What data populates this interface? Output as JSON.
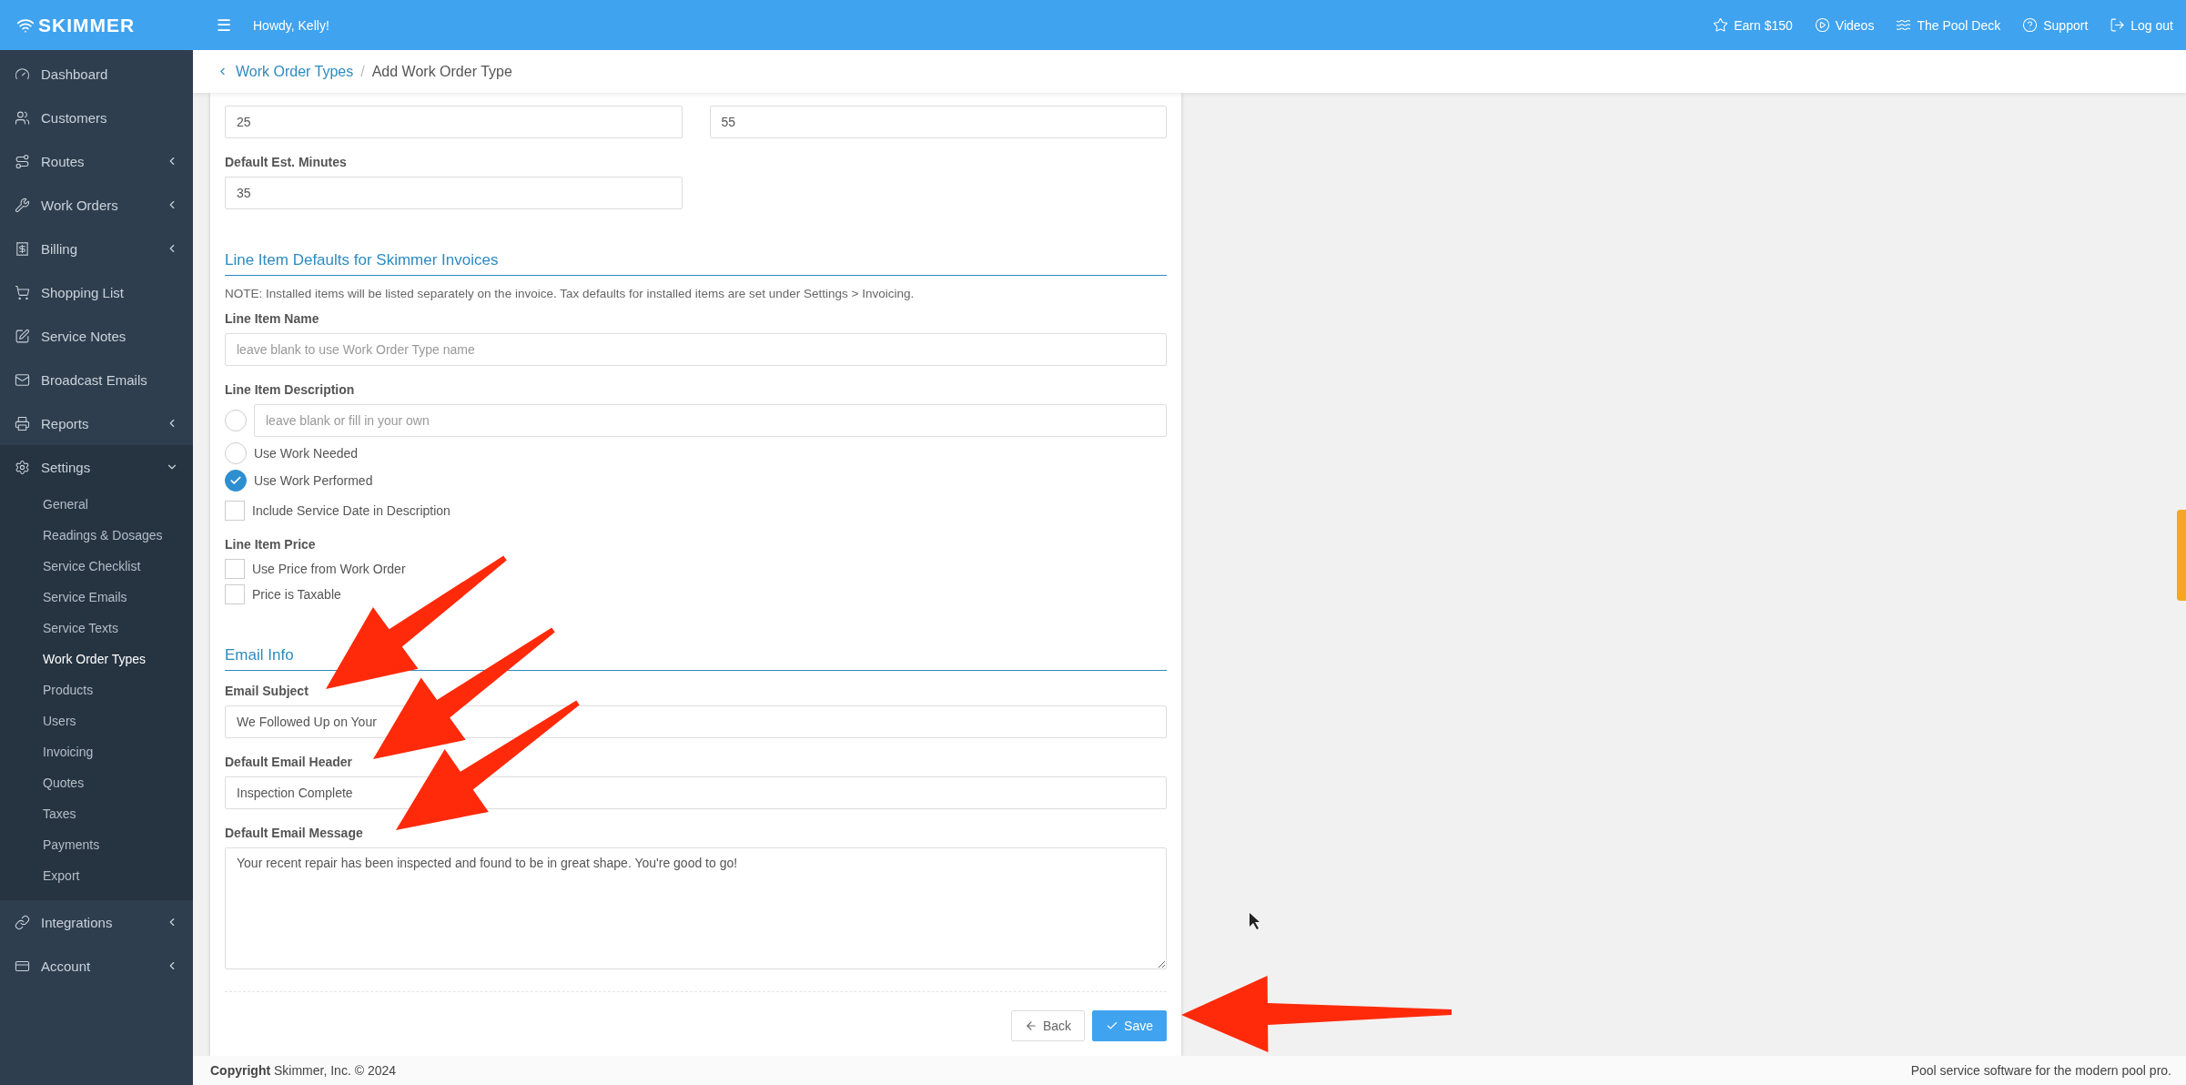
{
  "brand": "SKIMMER",
  "topbar": {
    "greeting": "Howdy, Kelly!",
    "menu_glyph": "☰",
    "links": [
      {
        "label": "Earn $150"
      },
      {
        "label": "Videos"
      },
      {
        "label": "The Pool Deck"
      },
      {
        "label": "Support"
      },
      {
        "label": "Log out"
      }
    ]
  },
  "sidebar": {
    "items": [
      {
        "label": "Dashboard",
        "has_submenu": false,
        "expanded": false
      },
      {
        "label": "Customers",
        "has_submenu": false,
        "expanded": false
      },
      {
        "label": "Routes",
        "has_submenu": true,
        "expanded": false
      },
      {
        "label": "Work Orders",
        "has_submenu": true,
        "expanded": false
      },
      {
        "label": "Billing",
        "has_submenu": true,
        "expanded": false
      },
      {
        "label": "Shopping List",
        "has_submenu": false,
        "expanded": false
      },
      {
        "label": "Service Notes",
        "has_submenu": false,
        "expanded": false
      },
      {
        "label": "Broadcast Emails",
        "has_submenu": false,
        "expanded": false
      },
      {
        "label": "Reports",
        "has_submenu": true,
        "expanded": false
      },
      {
        "label": "Settings",
        "has_submenu": true,
        "expanded": true,
        "children": [
          {
            "label": "General",
            "selected": false
          },
          {
            "label": "Readings & Dosages",
            "selected": false
          },
          {
            "label": "Service Checklist",
            "selected": false
          },
          {
            "label": "Service Emails",
            "selected": false
          },
          {
            "label": "Service Texts",
            "selected": false
          },
          {
            "label": "Work Order Types",
            "selected": true
          },
          {
            "label": "Products",
            "selected": false
          },
          {
            "label": "Users",
            "selected": false
          },
          {
            "label": "Invoicing",
            "selected": false
          },
          {
            "label": "Quotes",
            "selected": false
          },
          {
            "label": "Taxes",
            "selected": false
          },
          {
            "label": "Payments",
            "selected": false
          },
          {
            "label": "Export",
            "selected": false
          }
        ]
      },
      {
        "label": "Integrations",
        "has_submenu": true,
        "expanded": false
      },
      {
        "label": "Account",
        "has_submenu": true,
        "expanded": false
      }
    ]
  },
  "breadcrumb": {
    "parent": "Work Order Types",
    "separator": "/",
    "current": "Add Work Order Type"
  },
  "form": {
    "top_fields": [
      {
        "value": "25"
      },
      {
        "value": "55"
      }
    ],
    "est_minutes": {
      "label": "Default Est. Minutes",
      "value": "35"
    },
    "line_item_section": {
      "heading": "Line Item Defaults for Skimmer Invoices",
      "note": "NOTE: Installed items will be listed separately on the invoice. Tax defaults for installed items are set under Settings > Invoicing.",
      "name_label": "Line Item Name",
      "name_placeholder": "leave blank to use Work Order Type name",
      "description_label": "Line Item Description",
      "description_options": [
        {
          "kind": "input",
          "placeholder": "leave blank or fill in your own",
          "selected": false
        },
        {
          "kind": "text",
          "label": "Use Work Needed",
          "selected": false
        },
        {
          "kind": "text",
          "label": "Use Work Performed",
          "selected": true
        }
      ],
      "include_date": {
        "label": "Include Service Date in Description",
        "checked": false
      },
      "price_label": "Line Item Price",
      "price_options": [
        {
          "label": "Use Price from Work Order",
          "checked": false
        },
        {
          "label": "Price is Taxable",
          "checked": false
        }
      ]
    },
    "email_section": {
      "heading": "Email Info",
      "fields": [
        {
          "kind": "input",
          "label": "Email Subject",
          "value": "We Followed Up on Your"
        },
        {
          "kind": "input",
          "label": "Default Email Header",
          "value": "Inspection Complete"
        },
        {
          "kind": "textarea",
          "label": "Default Email Message",
          "value": "Your recent repair has been inspected and found to be in great shape. You're good to go!"
        }
      ]
    },
    "buttons": [
      {
        "kind": "back",
        "label": "Back"
      },
      {
        "kind": "save",
        "label": "Save"
      }
    ]
  },
  "footer": {
    "copyright": "**Copyright** Skimmer, Inc. © 2024",
    "tagline": "Pool service software for the modern pool pro."
  }
}
